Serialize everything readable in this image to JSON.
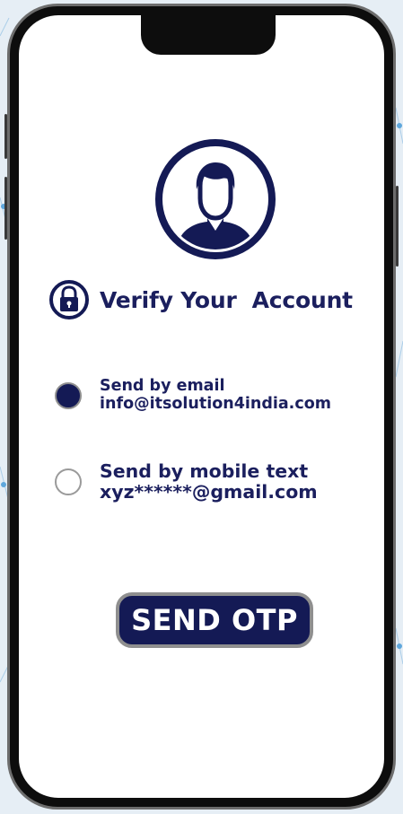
{
  "colors": {
    "primary": "#141a55",
    "text": "#1b1f5e",
    "radio_border": "#9a9a9a",
    "button_border": "#8f8f8f",
    "screen_bg": "#ffffff",
    "phone_frame": "#0d0d0d"
  },
  "icons": {
    "avatar": "user-avatar-icon",
    "lock": "lock-icon"
  },
  "header": {
    "title": "Verify Your  Account"
  },
  "options": [
    {
      "label": "Send by email",
      "value": "info@itsolution4india.com",
      "selected": true
    },
    {
      "label": "Send by mobile text",
      "value": "xyz******@gmail.com",
      "selected": false
    }
  ],
  "send_button": {
    "label": "SEND OTP"
  }
}
